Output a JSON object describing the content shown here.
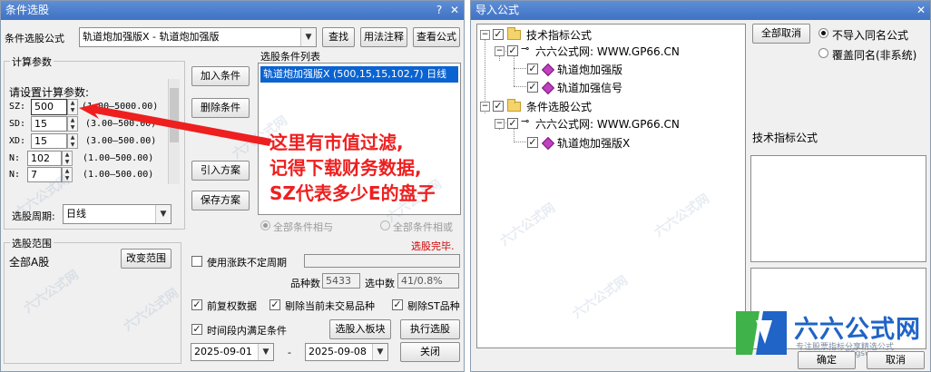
{
  "left_window": {
    "title": "条件选股",
    "formula_label": "条件选股公式",
    "formula_value": "轨道炮加强版X  -  轨道炮加强版",
    "find_button": "查找",
    "usage_button": "用法注释",
    "view_button": "查看公式",
    "calc_params": {
      "group_title": "计算参数",
      "prompt": "请设置计算参数:",
      "params": [
        {
          "name": "SZ:",
          "value": "500",
          "range": "(1.00—5000.00)"
        },
        {
          "name": "SD:",
          "value": "15",
          "range": "(3.00—500.00)"
        },
        {
          "name": "XD:",
          "value": "15",
          "range": "(3.00—500.00)"
        },
        {
          "name": "N:",
          "value": "102",
          "range": "(1.00—500.00)"
        },
        {
          "name": "N:",
          "value": "7",
          "range": "(1.00—500.00)"
        }
      ],
      "period_label": "选股周期:",
      "period_value": "日线"
    },
    "add_condition": "加入条件",
    "delete_condition": "删除条件",
    "import_plan": "引入方案",
    "save_plan": "保存方案",
    "condition_list_title": "选股条件列表",
    "condition_items": [
      "轨道炮加强版X (500,15,15,102,7) 日线"
    ],
    "radio_all_and": "全部条件相与",
    "radio_all_or": "全部条件相或",
    "status_text": "选股完毕.",
    "range_group": {
      "title": "选股范围",
      "value": "全部A股",
      "change_button": "改变范围"
    },
    "use_period_label": "使用涨跌不定周期",
    "stock_count_label": "品种数",
    "stock_count_value": "5433",
    "selected_label": "选中数",
    "selected_value": "41/0.8%",
    "prior_rights_label": "前复权数据",
    "exclude_untraded_label": "剔除当前未交易品种",
    "exclude_st_label": "剔除ST品种",
    "time_range_label": "时间段内满足条件",
    "add_to_block_button": "选股入板块",
    "execute_button": "执行选股",
    "date_from": "2025-09-01",
    "date_sep": "-",
    "date_to": "2025-09-08",
    "close_button": "关闭",
    "annotation_lines": [
      "这里有市值过滤,",
      "记得下载财务数据,",
      "SZ代表多少E的盘子"
    ]
  },
  "right_window": {
    "title": "导入公式",
    "tree": {
      "tech_root": "技术指标公式",
      "tech_site": "六六公式网: WWW.GP66.CN",
      "tech_items": [
        "轨道炮加强版",
        "轨道加强信号"
      ],
      "cond_root": "条件选股公式",
      "cond_site": "六六公式网: WWW.GP66.CN",
      "cond_items": [
        "轨道炮加强版X"
      ]
    },
    "cancel_all_button": "全部取消",
    "radio_no_import": "不导入同名公式",
    "radio_overwrite": "覆盖同名(非系统)",
    "section_label": "技术指标公式",
    "ok_button": "确定",
    "cancel_button": "取消",
    "logo_text": "六六公式网",
    "logo_subtext": "专注股票指标分享精选公式",
    "logo_url": "www.66gsw.com"
  },
  "colors": {
    "title_bar": "#4a7cc9",
    "selection": "#0a63d1",
    "annotation_red": "#ee1f1f",
    "status_red": "#d00000",
    "logo_green": "#3fb34a",
    "logo_blue": "#1f64c6"
  },
  "watermark_text": "六六公式网"
}
